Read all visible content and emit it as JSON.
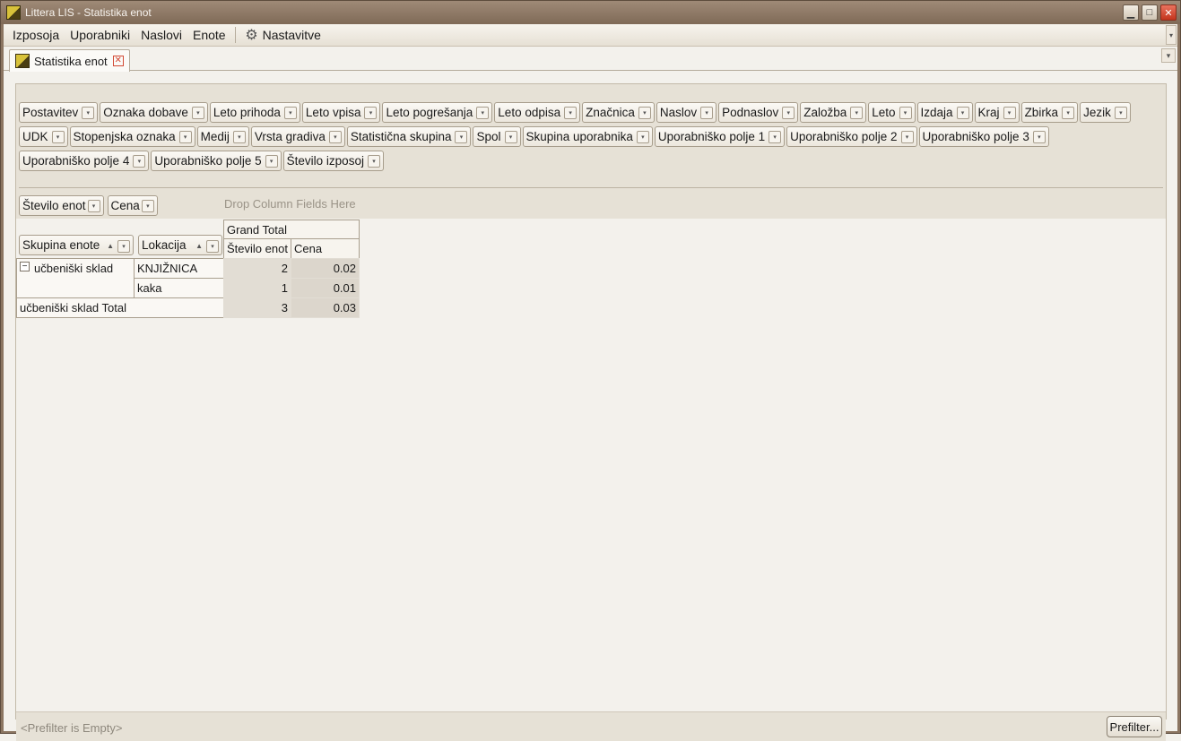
{
  "window": {
    "title": "Littera LIS - Statistika enot"
  },
  "menu": {
    "items": [
      "Izposoja",
      "Uporabniki",
      "Naslovi",
      "Enote"
    ],
    "settings_label": "Nastavitve"
  },
  "tab": {
    "label": "Statistika enot"
  },
  "filter_fields": {
    "row1": [
      "Postavitev",
      "Oznaka dobave",
      "Leto prihoda",
      "Leto vpisa",
      "Leto pogrešanja",
      "Leto odpisa",
      "Značnica",
      "Naslov",
      "Podnaslov",
      "Založba",
      "Leto",
      "Izdaja",
      "Kraj",
      "Zbirka",
      "Jezik"
    ],
    "row2": [
      "UDK",
      "Stopenjska oznaka",
      "Medij",
      "Vrsta gradiva",
      "Statistična skupina",
      "Spol",
      "Skupina uporabnika",
      "Uporabniško polje 1",
      "Uporabniško polje 2",
      "Uporabniško polje 3"
    ],
    "row3": [
      "Uporabniško polje 4",
      "Uporabniško polje 5",
      "Število izposoj"
    ]
  },
  "data_fields": [
    "Število enot",
    "Cena"
  ],
  "drop_column_text": "Drop Column Fields Here",
  "row_fields": [
    "Skupina enote",
    "Lokacija"
  ],
  "grid": {
    "grand_total": "Grand Total",
    "col_headers": [
      "Število enot",
      "Cena"
    ],
    "group": "učbeniški sklad",
    "rows": [
      {
        "location": "KNJIŽNICA",
        "count": "2",
        "price": "0.02"
      },
      {
        "location": "kaka",
        "count": "1",
        "price": "0.01"
      }
    ],
    "total_label": "učbeniški sklad Total",
    "total_count": "3",
    "total_price": "0.03"
  },
  "status": {
    "prefilter_text": "<Prefilter is Empty>",
    "prefilter_button": "Prefilter..."
  },
  "colors": {
    "titlebar": "#8b7561",
    "panel": "#e6e1d6",
    "data_cell": "#e2ddd4"
  }
}
